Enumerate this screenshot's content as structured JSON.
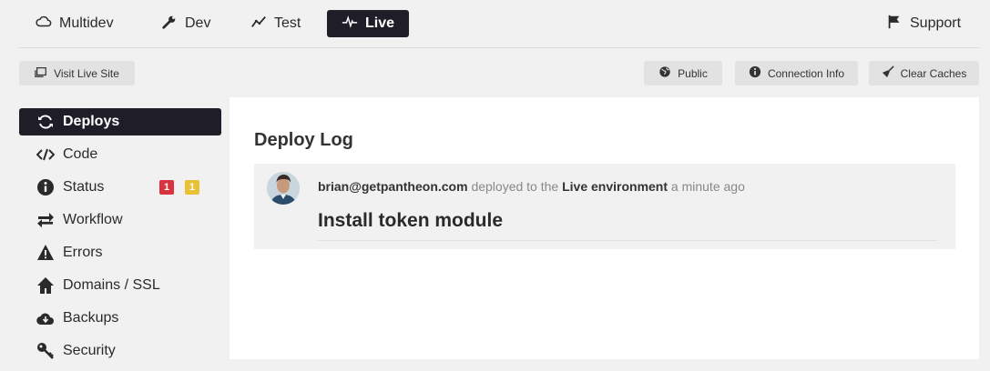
{
  "env_tabs": [
    {
      "label": "Multidev",
      "icon": "cloud-icon"
    },
    {
      "label": "Dev",
      "icon": "wrench-icon"
    },
    {
      "label": "Test",
      "icon": "line-chart-icon"
    },
    {
      "label": "Live",
      "icon": "pulse-icon",
      "active": true
    }
  ],
  "support": {
    "label": "Support",
    "icon": "flag-icon"
  },
  "toolbar": {
    "visit_live_site": "Visit Live Site",
    "public": "Public",
    "connection_info": "Connection Info",
    "clear_caches": "Clear Caches"
  },
  "sidebar": {
    "items": [
      {
        "label": "Deploys",
        "icon": "refresh-icon",
        "active": true
      },
      {
        "label": "Code",
        "icon": "code-icon"
      },
      {
        "label": "Status",
        "icon": "info-icon"
      },
      {
        "label": "Workflow",
        "icon": "arrows-icon"
      },
      {
        "label": "Errors",
        "icon": "warning-icon"
      },
      {
        "label": "Domains / SSL",
        "icon": "home-icon"
      },
      {
        "label": "Backups",
        "icon": "cloud-download-icon"
      },
      {
        "label": "Security",
        "icon": "key-icon"
      }
    ],
    "status_badges": [
      {
        "count": "1",
        "color": "#d9333f"
      },
      {
        "count": "1",
        "color": "#e8c136"
      }
    ]
  },
  "main": {
    "title": "Deploy Log",
    "entry": {
      "user": "brian@getpantheon.com",
      "action": "deployed to the",
      "env": "Live environment",
      "time": "a minute ago",
      "message": "Install token module"
    }
  },
  "colors": {
    "dark": "#1e1d28",
    "button": "#e2e2e2",
    "background": "#f1f1f1"
  }
}
